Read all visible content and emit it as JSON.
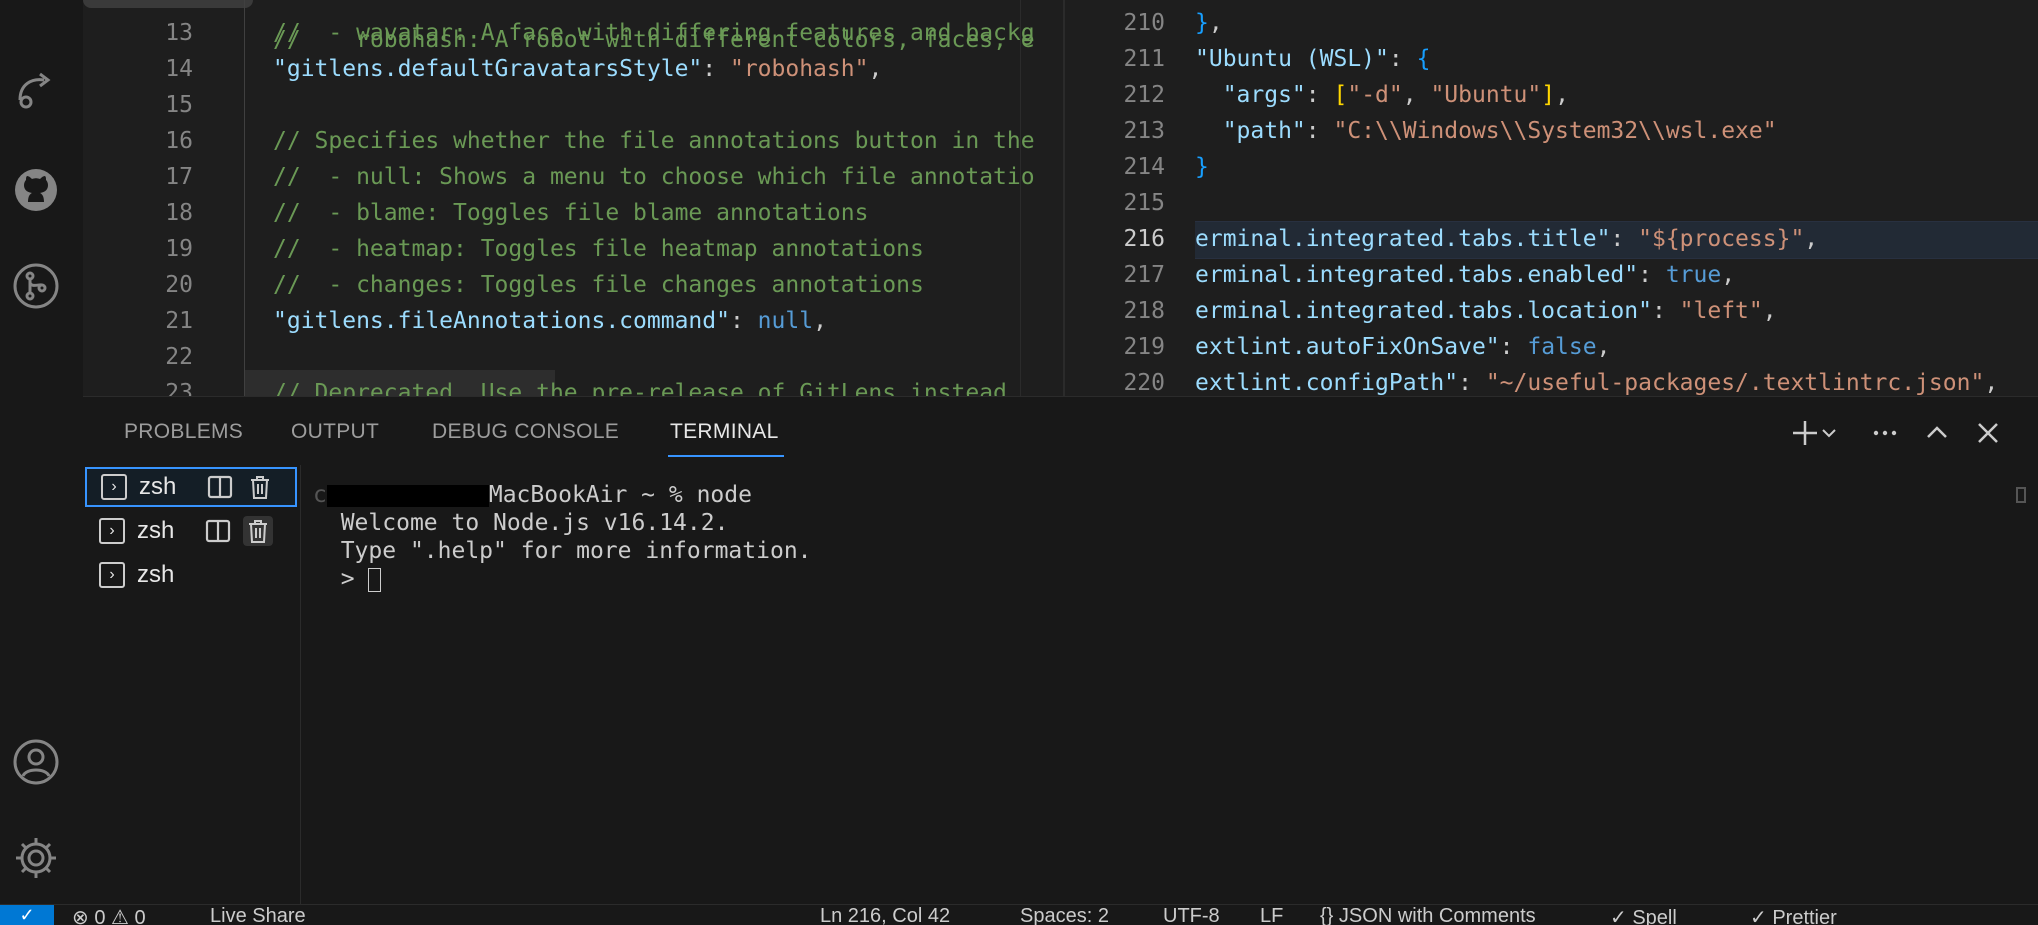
{
  "left_editor": {
    "top_hint": "robohash: A robot with different colors, faces, e",
    "lines": [
      {
        "n": "13",
        "segs": [
          {
            "c": "cmt",
            "t": "//  - wavatar: A face with differing features and backg"
          }
        ]
      },
      {
        "n": "14",
        "segs": [
          {
            "c": "key",
            "t": "\"gitlens.defaultGravatarsStyle\""
          },
          {
            "c": "pun",
            "t": ": "
          },
          {
            "c": "str",
            "t": "\"robohash\""
          },
          {
            "c": "pun",
            "t": ","
          }
        ]
      },
      {
        "n": "15",
        "segs": []
      },
      {
        "n": "16",
        "segs": [
          {
            "c": "cmt",
            "t": "// Specifies whether the file annotations button in the"
          }
        ]
      },
      {
        "n": "17",
        "segs": [
          {
            "c": "cmt",
            "t": "//  - null: Shows a menu to choose which file annotatio"
          }
        ]
      },
      {
        "n": "18",
        "segs": [
          {
            "c": "cmt",
            "t": "//  - blame: Toggles file blame annotations"
          }
        ]
      },
      {
        "n": "19",
        "segs": [
          {
            "c": "cmt",
            "t": "//  - heatmap: Toggles file heatmap annotations"
          }
        ]
      },
      {
        "n": "20",
        "segs": [
          {
            "c": "cmt",
            "t": "//  - changes: Toggles file changes annotations"
          }
        ]
      },
      {
        "n": "21",
        "segs": [
          {
            "c": "key",
            "t": "\"gitlens.fileAnnotations.command\""
          },
          {
            "c": "pun",
            "t": ": "
          },
          {
            "c": "kw",
            "t": "null"
          },
          {
            "c": "pun",
            "t": ","
          }
        ]
      },
      {
        "n": "22",
        "segs": []
      },
      {
        "n": "23",
        "segs": [
          {
            "c": "cmt",
            "t": "// Deprecated. Use the pre-release of GitLens instead"
          }
        ]
      }
    ]
  },
  "right_editor": {
    "active_line": "216",
    "lines": [
      {
        "n": "210",
        "segs": [
          {
            "c": "brk2",
            "t": "}"
          },
          {
            "c": "pun",
            "t": ","
          }
        ]
      },
      {
        "n": "211",
        "segs": [
          {
            "c": "key",
            "t": "\"Ubuntu (WSL)\""
          },
          {
            "c": "pun",
            "t": ": "
          },
          {
            "c": "brk2",
            "t": "{"
          }
        ]
      },
      {
        "n": "212",
        "segs": [
          {
            "c": "key",
            "t": "  \"args\""
          },
          {
            "c": "pun",
            "t": ": "
          },
          {
            "c": "brk",
            "t": "["
          },
          {
            "c": "str",
            "t": "\"-d\""
          },
          {
            "c": "pun",
            "t": ", "
          },
          {
            "c": "str",
            "t": "\"Ubuntu\""
          },
          {
            "c": "brk",
            "t": "]"
          },
          {
            "c": "pun",
            "t": ","
          }
        ]
      },
      {
        "n": "213",
        "segs": [
          {
            "c": "key",
            "t": "  \"path\""
          },
          {
            "c": "pun",
            "t": ": "
          },
          {
            "c": "str",
            "t": "\"C:\\\\Windows\\\\System32\\\\wsl.exe\""
          }
        ]
      },
      {
        "n": "214",
        "segs": [
          {
            "c": "brk2",
            "t": "}"
          }
        ]
      },
      {
        "n": "215",
        "segs": []
      },
      {
        "n": "216",
        "segs": [
          {
            "c": "key",
            "t": "erminal.integrated.tabs.title\""
          },
          {
            "c": "pun",
            "t": ": "
          },
          {
            "c": "str",
            "t": "\"${process}\""
          },
          {
            "c": "pun",
            "t": ","
          }
        ]
      },
      {
        "n": "217",
        "segs": [
          {
            "c": "key",
            "t": "erminal.integrated.tabs.enabled\""
          },
          {
            "c": "pun",
            "t": ": "
          },
          {
            "c": "kw",
            "t": "true"
          },
          {
            "c": "pun",
            "t": ","
          }
        ]
      },
      {
        "n": "218",
        "segs": [
          {
            "c": "key",
            "t": "erminal.integrated.tabs.location\""
          },
          {
            "c": "pun",
            "t": ": "
          },
          {
            "c": "str",
            "t": "\"left\""
          },
          {
            "c": "pun",
            "t": ","
          }
        ]
      },
      {
        "n": "219",
        "segs": [
          {
            "c": "key",
            "t": "extlint.autoFixOnSave\""
          },
          {
            "c": "pun",
            "t": ": "
          },
          {
            "c": "kw",
            "t": "false"
          },
          {
            "c": "pun",
            "t": ","
          }
        ]
      },
      {
        "n": "220",
        "segs": [
          {
            "c": "key",
            "t": "extlint.configPath\""
          },
          {
            "c": "pun",
            "t": ": "
          },
          {
            "c": "str",
            "t": "\"~/useful-packages/.textlintrc.json\""
          },
          {
            "c": "pun",
            "t": ","
          }
        ]
      }
    ]
  },
  "panel": {
    "tabs": [
      "PROBLEMS",
      "OUTPUT",
      "DEBUG CONSOLE",
      "TERMINAL"
    ],
    "active_tab": "TERMINAL",
    "terminals": [
      {
        "label": "zsh",
        "selected": true,
        "actions": true
      },
      {
        "label": "zsh",
        "selected": false,
        "actions": true
      },
      {
        "label": "zsh",
        "selected": false,
        "actions": false
      }
    ],
    "terminal_output": {
      "prompt_suffix": "MacBookAir ~ % node",
      "line2": "Welcome to Node.js v16.14.2.",
      "line3": "Type \".help\" for more information.",
      "line4": "> "
    }
  },
  "status_bar": {
    "items": [
      "⊗ 0 ⚠ 0",
      "Live Share",
      "Ln 216, Col 42",
      "Spaces: 2",
      "UTF-8",
      "LF",
      "{} JSON with Comments",
      "✓ Spell",
      "✓ Prettier"
    ]
  },
  "colors": {
    "accent": "#3794ff",
    "status_remote": "#0078d4"
  }
}
